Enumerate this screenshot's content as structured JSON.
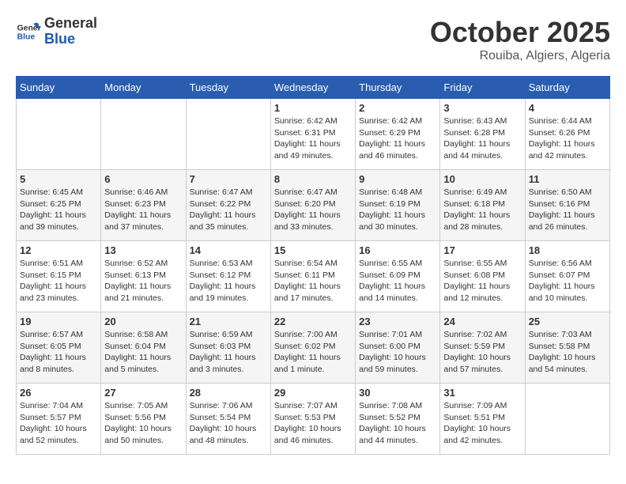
{
  "header": {
    "logo_line1": "General",
    "logo_line2": "Blue",
    "month": "October 2025",
    "location": "Rouiba, Algiers, Algeria"
  },
  "weekdays": [
    "Sunday",
    "Monday",
    "Tuesday",
    "Wednesday",
    "Thursday",
    "Friday",
    "Saturday"
  ],
  "weeks": [
    [
      {
        "day": "",
        "info": ""
      },
      {
        "day": "",
        "info": ""
      },
      {
        "day": "",
        "info": ""
      },
      {
        "day": "1",
        "info": "Sunrise: 6:42 AM\nSunset: 6:31 PM\nDaylight: 11 hours and 49 minutes."
      },
      {
        "day": "2",
        "info": "Sunrise: 6:42 AM\nSunset: 6:29 PM\nDaylight: 11 hours and 46 minutes."
      },
      {
        "day": "3",
        "info": "Sunrise: 6:43 AM\nSunset: 6:28 PM\nDaylight: 11 hours and 44 minutes."
      },
      {
        "day": "4",
        "info": "Sunrise: 6:44 AM\nSunset: 6:26 PM\nDaylight: 11 hours and 42 minutes."
      }
    ],
    [
      {
        "day": "5",
        "info": "Sunrise: 6:45 AM\nSunset: 6:25 PM\nDaylight: 11 hours and 39 minutes."
      },
      {
        "day": "6",
        "info": "Sunrise: 6:46 AM\nSunset: 6:23 PM\nDaylight: 11 hours and 37 minutes."
      },
      {
        "day": "7",
        "info": "Sunrise: 6:47 AM\nSunset: 6:22 PM\nDaylight: 11 hours and 35 minutes."
      },
      {
        "day": "8",
        "info": "Sunrise: 6:47 AM\nSunset: 6:20 PM\nDaylight: 11 hours and 33 minutes."
      },
      {
        "day": "9",
        "info": "Sunrise: 6:48 AM\nSunset: 6:19 PM\nDaylight: 11 hours and 30 minutes."
      },
      {
        "day": "10",
        "info": "Sunrise: 6:49 AM\nSunset: 6:18 PM\nDaylight: 11 hours and 28 minutes."
      },
      {
        "day": "11",
        "info": "Sunrise: 6:50 AM\nSunset: 6:16 PM\nDaylight: 11 hours and 26 minutes."
      }
    ],
    [
      {
        "day": "12",
        "info": "Sunrise: 6:51 AM\nSunset: 6:15 PM\nDaylight: 11 hours and 23 minutes."
      },
      {
        "day": "13",
        "info": "Sunrise: 6:52 AM\nSunset: 6:13 PM\nDaylight: 11 hours and 21 minutes."
      },
      {
        "day": "14",
        "info": "Sunrise: 6:53 AM\nSunset: 6:12 PM\nDaylight: 11 hours and 19 minutes."
      },
      {
        "day": "15",
        "info": "Sunrise: 6:54 AM\nSunset: 6:11 PM\nDaylight: 11 hours and 17 minutes."
      },
      {
        "day": "16",
        "info": "Sunrise: 6:55 AM\nSunset: 6:09 PM\nDaylight: 11 hours and 14 minutes."
      },
      {
        "day": "17",
        "info": "Sunrise: 6:55 AM\nSunset: 6:08 PM\nDaylight: 11 hours and 12 minutes."
      },
      {
        "day": "18",
        "info": "Sunrise: 6:56 AM\nSunset: 6:07 PM\nDaylight: 11 hours and 10 minutes."
      }
    ],
    [
      {
        "day": "19",
        "info": "Sunrise: 6:57 AM\nSunset: 6:05 PM\nDaylight: 11 hours and 8 minutes."
      },
      {
        "day": "20",
        "info": "Sunrise: 6:58 AM\nSunset: 6:04 PM\nDaylight: 11 hours and 5 minutes."
      },
      {
        "day": "21",
        "info": "Sunrise: 6:59 AM\nSunset: 6:03 PM\nDaylight: 11 hours and 3 minutes."
      },
      {
        "day": "22",
        "info": "Sunrise: 7:00 AM\nSunset: 6:02 PM\nDaylight: 11 hours and 1 minute."
      },
      {
        "day": "23",
        "info": "Sunrise: 7:01 AM\nSunset: 6:00 PM\nDaylight: 10 hours and 59 minutes."
      },
      {
        "day": "24",
        "info": "Sunrise: 7:02 AM\nSunset: 5:59 PM\nDaylight: 10 hours and 57 minutes."
      },
      {
        "day": "25",
        "info": "Sunrise: 7:03 AM\nSunset: 5:58 PM\nDaylight: 10 hours and 54 minutes."
      }
    ],
    [
      {
        "day": "26",
        "info": "Sunrise: 7:04 AM\nSunset: 5:57 PM\nDaylight: 10 hours and 52 minutes."
      },
      {
        "day": "27",
        "info": "Sunrise: 7:05 AM\nSunset: 5:56 PM\nDaylight: 10 hours and 50 minutes."
      },
      {
        "day": "28",
        "info": "Sunrise: 7:06 AM\nSunset: 5:54 PM\nDaylight: 10 hours and 48 minutes."
      },
      {
        "day": "29",
        "info": "Sunrise: 7:07 AM\nSunset: 5:53 PM\nDaylight: 10 hours and 46 minutes."
      },
      {
        "day": "30",
        "info": "Sunrise: 7:08 AM\nSunset: 5:52 PM\nDaylight: 10 hours and 44 minutes."
      },
      {
        "day": "31",
        "info": "Sunrise: 7:09 AM\nSunset: 5:51 PM\nDaylight: 10 hours and 42 minutes."
      },
      {
        "day": "",
        "info": ""
      }
    ]
  ]
}
